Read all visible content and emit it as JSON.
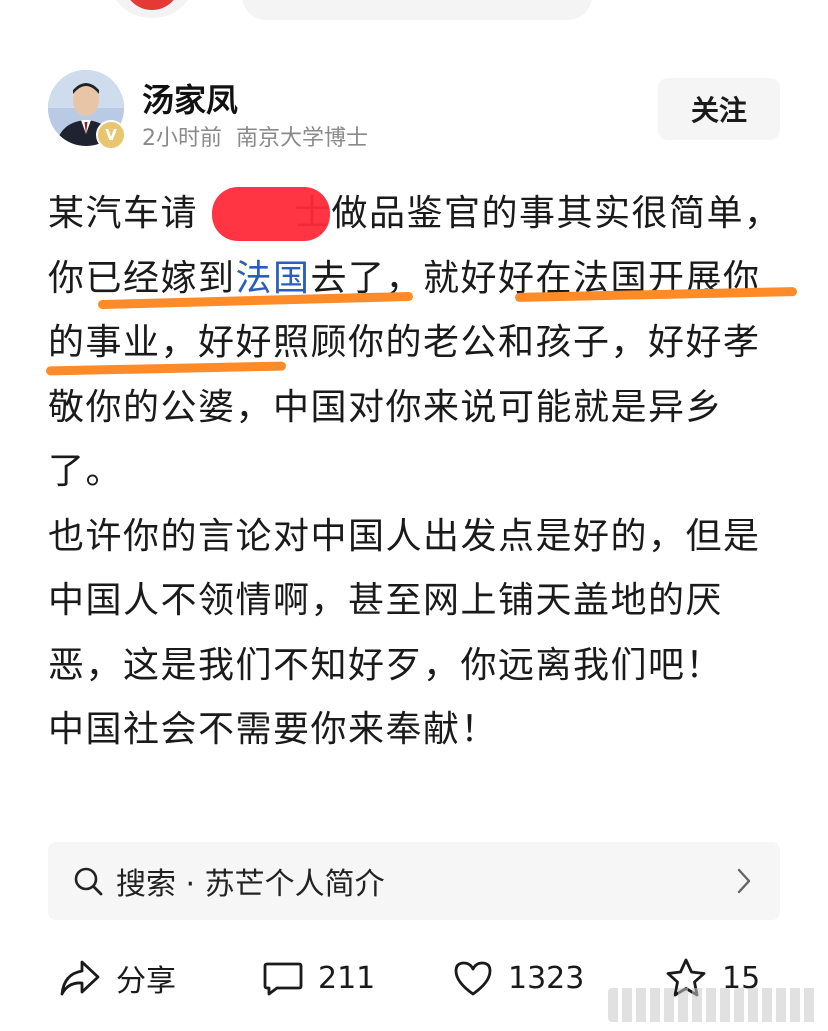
{
  "author": {
    "name": "汤家凤",
    "time": "2小时前",
    "title": "南京大学博士",
    "badge": "V",
    "follow_label": "关注"
  },
  "post": {
    "p1_a": "某汽车请",
    "p1_b": "士做品鉴官的事其实很简单，",
    "p1_c": "你已经嫁到",
    "p1_link": "法国",
    "p1_d": "去了，就好好在法国开展你的事业，好好照顾你的老公和孩子，好好孝敬你的公婆，中国对你来说可能就是异乡了。",
    "p2": "也许你的言论对中国人出发点是好的，但是中国人不领情啊，甚至网上铺天盖地的厌恶，这是我们不知好歹，你远离我们吧！",
    "p3": "中国社会不需要你来奉献！"
  },
  "search": {
    "text": "搜索 · 苏芒个人简介"
  },
  "actions": {
    "share_label": "分享",
    "comment_count": "211",
    "like_count": "1323",
    "favorite_count": "15"
  },
  "colors": {
    "link": "#2a5dc0",
    "highlight": "#ff8a28",
    "redaction": "#ff2a3a",
    "verified": "#e8c66f"
  }
}
